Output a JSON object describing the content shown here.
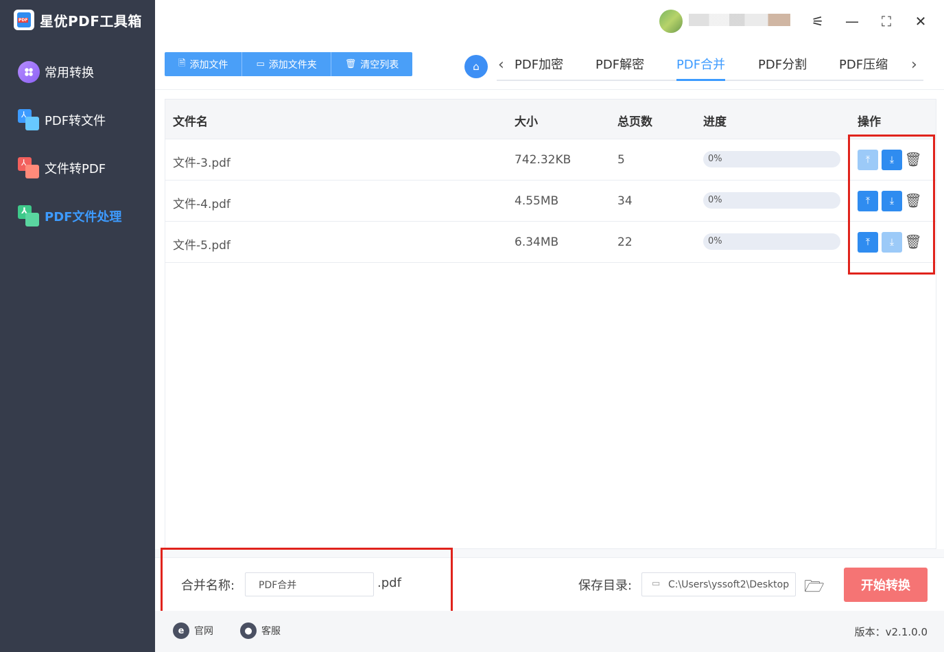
{
  "app": {
    "title": "星优PDF工具箱"
  },
  "sidebar": {
    "items": [
      {
        "label": "常用转换",
        "icon": "apps-icon",
        "active": false
      },
      {
        "label": "PDF转文件",
        "icon": "pdf-to-file-icon",
        "active": false
      },
      {
        "label": "文件转PDF",
        "icon": "file-to-pdf-icon",
        "active": false
      },
      {
        "label": "PDF文件处理",
        "icon": "pdf-process-icon",
        "active": true
      }
    ]
  },
  "window": {
    "settings_icon": "sliders-icon",
    "min_icon": "minimize-icon",
    "max_icon": "maximize-icon",
    "close_icon": "close-icon"
  },
  "toolbar": {
    "add_file": "添加文件",
    "add_folder": "添加文件夹",
    "clear_list": "清空列表"
  },
  "tabs": [
    {
      "label": "PDF加密",
      "active": false
    },
    {
      "label": "PDF解密",
      "active": false
    },
    {
      "label": "PDF合并",
      "active": true
    },
    {
      "label": "PDF分割",
      "active": false
    },
    {
      "label": "PDF压缩",
      "active": false
    }
  ],
  "table": {
    "headers": {
      "name": "文件名",
      "size": "大小",
      "pages": "总页数",
      "progress": "进度",
      "ops": "操作"
    },
    "rows": [
      {
        "name": "文件-3.pdf",
        "size": "742.32KB",
        "pages": "5",
        "progress": "0%",
        "up_enabled": false,
        "down_enabled": true
      },
      {
        "name": "文件-4.pdf",
        "size": "4.55MB",
        "pages": "34",
        "progress": "0%",
        "up_enabled": true,
        "down_enabled": true
      },
      {
        "name": "文件-5.pdf",
        "size": "6.34MB",
        "pages": "22",
        "progress": "0%",
        "up_enabled": true,
        "down_enabled": false
      }
    ]
  },
  "bottom": {
    "merge_label": "合并名称:",
    "merge_value": "PDF合并",
    "merge_ext": ".pdf",
    "save_label": "保存目录:",
    "save_path": "C:\\Users\\yssoft2\\Desktop",
    "start_label": "开始转换"
  },
  "footer": {
    "website": "官网",
    "support": "客服",
    "version": "版本：v2.1.0.0"
  },
  "colors": {
    "sidebar_bg": "#363c4b",
    "accent": "#3d9bff",
    "start_button": "#f57474",
    "highlight_box": "#e0231c"
  }
}
